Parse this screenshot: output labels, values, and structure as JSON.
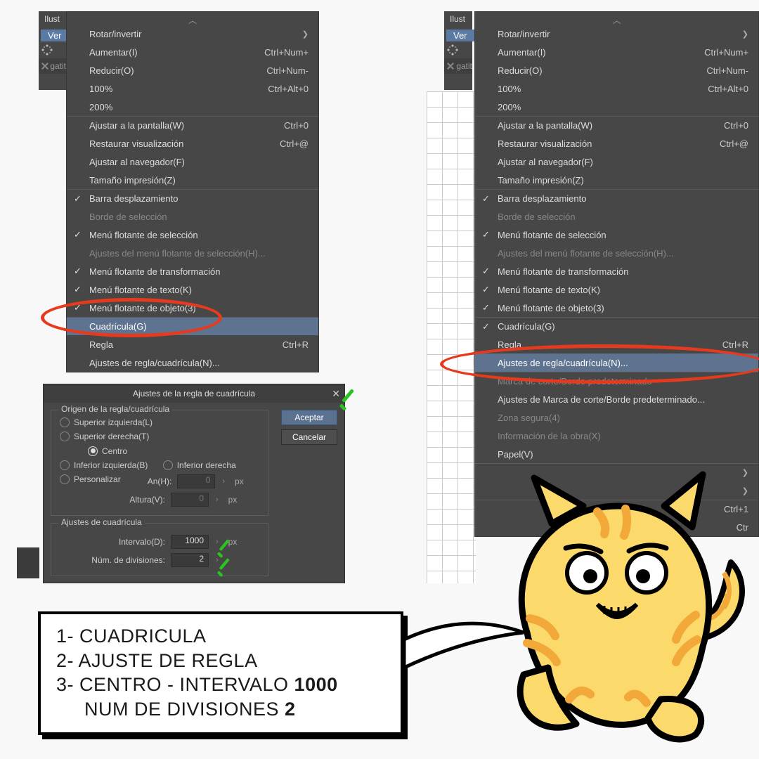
{
  "app_title": "Ilust",
  "ver_button": "Ver",
  "tab_name": "gatit",
  "menu_left": {
    "items": [
      {
        "label": "Rotar/invertir",
        "arrow": true
      },
      {
        "label": "Aumentar(I)",
        "shortcut": "Ctrl+Num+"
      },
      {
        "label": "Reducir(O)",
        "shortcut": "Ctrl+Num-"
      },
      {
        "label": "100%",
        "shortcut": "Ctrl+Alt+0"
      },
      {
        "label": "200%"
      },
      {
        "label": "Ajustar a la pantalla(W)",
        "shortcut": "Ctrl+0",
        "sep": true
      },
      {
        "label": "Restaurar visualización",
        "shortcut": "Ctrl+@"
      },
      {
        "label": "Ajustar al navegador(F)"
      },
      {
        "label": "Tamaño impresión(Z)"
      },
      {
        "label": "Barra desplazamiento",
        "check": true,
        "sep": true
      },
      {
        "label": "Borde de selección",
        "disabled": true
      },
      {
        "label": "Menú flotante de selección",
        "check": true
      },
      {
        "label": "Ajustes del menú flotante de selección(H)...",
        "disabled": true
      },
      {
        "label": "Menú flotante de transformación",
        "check": true
      },
      {
        "label": "Menú flotante de texto(K)",
        "check": true
      },
      {
        "label": "Menú flotante de objeto(3)",
        "check": true
      },
      {
        "label": "Cuadrícula(G)",
        "highlight": true,
        "sep": true
      },
      {
        "label": "Regla",
        "shortcut": "Ctrl+R"
      },
      {
        "label": "Ajustes de regla/cuadrícula(N)..."
      }
    ]
  },
  "menu_right": {
    "items": [
      {
        "label": "Rotar/invertir",
        "arrow": true
      },
      {
        "label": "Aumentar(I)",
        "shortcut": "Ctrl+Num+"
      },
      {
        "label": "Reducir(O)",
        "shortcut": "Ctrl+Num-"
      },
      {
        "label": "100%",
        "shortcut": "Ctrl+Alt+0"
      },
      {
        "label": "200%"
      },
      {
        "label": "Ajustar a la pantalla(W)",
        "shortcut": "Ctrl+0",
        "sep": true
      },
      {
        "label": "Restaurar visualización",
        "shortcut": "Ctrl+@"
      },
      {
        "label": "Ajustar al navegador(F)"
      },
      {
        "label": "Tamaño impresión(Z)"
      },
      {
        "label": "Barra desplazamiento",
        "check": true,
        "sep": true
      },
      {
        "label": "Borde de selección",
        "disabled": true
      },
      {
        "label": "Menú flotante de selección",
        "check": true
      },
      {
        "label": "Ajustes del menú flotante de selección(H)...",
        "disabled": true
      },
      {
        "label": "Menú flotante de transformación",
        "check": true
      },
      {
        "label": "Menú flotante de texto(K)",
        "check": true
      },
      {
        "label": "Menú flotante de objeto(3)",
        "check": true
      },
      {
        "label": "Cuadrícula(G)",
        "check": true,
        "sep": true
      },
      {
        "label": "Regla",
        "shortcut": "Ctrl+R"
      },
      {
        "label": "Ajustes de regla/cuadrícula(N)...",
        "highlight": true
      },
      {
        "label": "Marca de corte/Borde predeterminado",
        "disabled": true,
        "sep": true
      },
      {
        "label": "Ajustes de Marca de corte/Borde predeterminado..."
      },
      {
        "label": "Zona segura(4)",
        "disabled": true
      },
      {
        "label": "Información de la obra(X)",
        "disabled": true
      },
      {
        "label": "Papel(V)"
      },
      {
        "label": "",
        "arrow": true,
        "sep": true
      },
      {
        "label": "",
        "arrow": true
      },
      {
        "label": "",
        "shortcut": "Ctrl+1",
        "sep": true
      },
      {
        "label": "",
        "shortcut": "Ctr"
      }
    ]
  },
  "dialog": {
    "title": "Ajustes de la regla de cuadrícula",
    "accept": "Aceptar",
    "cancel": "Cancelar",
    "fs1_legend": "Origen de la regla/cuadrícula",
    "r_sup_izq": "Superior izquierda(L)",
    "r_sup_der": "Superior derecha(T)",
    "r_centro": "Centro",
    "r_inf_izq": "Inferior izquierda(B)",
    "r_inf_der": "Inferior derecha",
    "r_pers": "Personalizar",
    "an_label": "An(H):",
    "an_value": "0",
    "alt_label": "Altura(V):",
    "alt_value": "0",
    "px": "px",
    "fs2_legend": "Ajustes de cuadrícula",
    "intervalo_label": "Intervalo(D):",
    "intervalo_value": "1000",
    "divisiones_label": "Núm. de divisiones:",
    "divisiones_value": "2"
  },
  "note": {
    "l1": "1- CUADRICULA",
    "l2": "2- AJUSTE DE REGLA",
    "l3a": "3- CENTRO - INTERVALO ",
    "l3b": "1000",
    "l4a": "  NUM DE DIVISIONES ",
    "l4b": "2"
  }
}
